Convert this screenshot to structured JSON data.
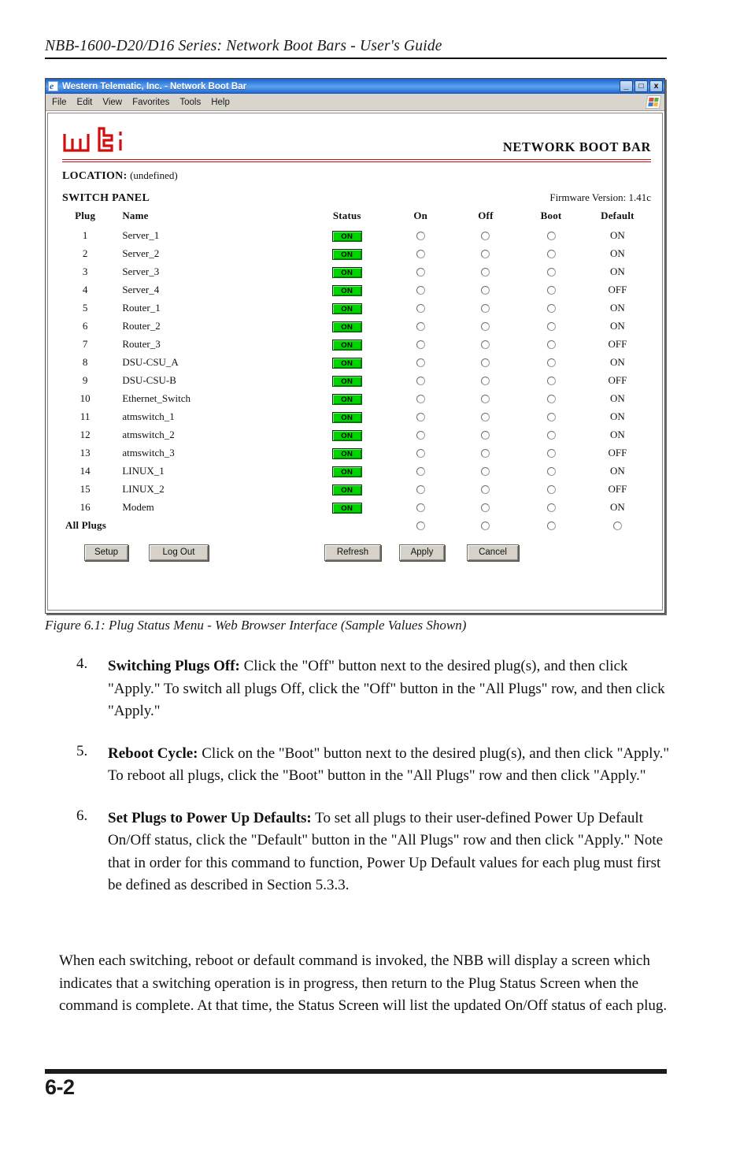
{
  "running_head": "NBB-1600-D20/D16 Series: Network Boot Bars - User's Guide",
  "browser": {
    "title": "Western Telematic, Inc. - Network Boot Bar",
    "title_icon": "internet-explorer-icon",
    "window_buttons": {
      "minimize": "_",
      "maximize": "□",
      "close": "x"
    },
    "menu": [
      "File",
      "Edit",
      "View",
      "Favorites",
      "Tools",
      "Help"
    ],
    "brand_icon": "windows-flag-icon"
  },
  "page": {
    "logo_text": "wti",
    "logo_color": "#d01010",
    "header_title": "NETWORK BOOT BAR",
    "location_label": "LOCATION:",
    "location_value": "(undefined)",
    "panel_title": "SWITCH PANEL",
    "firmware_label": "Firmware Version:",
    "firmware_value": "1.41c",
    "firmware_line": "Firmware Version: 1.41c"
  },
  "table": {
    "headers": [
      "Plug",
      "Name",
      "Status",
      "On",
      "Off",
      "Boot",
      "Default"
    ],
    "status_on_label": "ON",
    "rows": [
      {
        "plug": "1",
        "name": "Server_1",
        "status": "ON",
        "default": "ON"
      },
      {
        "plug": "2",
        "name": "Server_2",
        "status": "ON",
        "default": "ON"
      },
      {
        "plug": "3",
        "name": "Server_3",
        "status": "ON",
        "default": "ON"
      },
      {
        "plug": "4",
        "name": "Server_4",
        "status": "ON",
        "default": "OFF"
      },
      {
        "plug": "5",
        "name": "Router_1",
        "status": "ON",
        "default": "ON"
      },
      {
        "plug": "6",
        "name": "Router_2",
        "status": "ON",
        "default": "ON"
      },
      {
        "plug": "7",
        "name": "Router_3",
        "status": "ON",
        "default": "OFF"
      },
      {
        "plug": "8",
        "name": "DSU-CSU_A",
        "status": "ON",
        "default": "ON"
      },
      {
        "plug": "9",
        "name": "DSU-CSU-B",
        "status": "ON",
        "default": "OFF"
      },
      {
        "plug": "10",
        "name": "Ethernet_Switch",
        "status": "ON",
        "default": "ON"
      },
      {
        "plug": "11",
        "name": "atmswitch_1",
        "status": "ON",
        "default": "ON"
      },
      {
        "plug": "12",
        "name": "atmswitch_2",
        "status": "ON",
        "default": "ON"
      },
      {
        "plug": "13",
        "name": "atmswitch_3",
        "status": "ON",
        "default": "OFF"
      },
      {
        "plug": "14",
        "name": "LINUX_1",
        "status": "ON",
        "default": "ON"
      },
      {
        "plug": "15",
        "name": "LINUX_2",
        "status": "ON",
        "default": "OFF"
      },
      {
        "plug": "16",
        "name": "Modem",
        "status": "ON",
        "default": "ON"
      }
    ],
    "all_plugs_label": "All Plugs"
  },
  "buttons": {
    "setup": "Setup",
    "logout": "Log Out",
    "refresh": "Refresh",
    "apply": "Apply",
    "cancel": "Cancel"
  },
  "figure_caption": "Figure 6.1:  Plug Status Menu - Web Browser Interface (Sample Values Shown)",
  "steps": [
    {
      "number": "4.",
      "title": "Switching Plugs Off:",
      "text": "  Click the \"Off\" button next to the desired plug(s), and then click \"Apply.\"  To switch all plugs Off, click the \"Off\" button in the \"All Plugs\" row, and then click \"Apply.\""
    },
    {
      "number": "5.",
      "title": "Reboot Cycle:",
      "text": "  Click on the \"Boot\" button next to the desired plug(s), and then click \"Apply.\"  To reboot all plugs, click the \"Boot\" button in the \"All Plugs\" row and then click \"Apply.\""
    },
    {
      "number": "6.",
      "title": "Set Plugs to Power Up Defaults:",
      "text": "  To set all plugs to their user-defined Power Up Default On/Off status, click the \"Default\" button in the \"All Plugs\" row and then click \"Apply.\"  Note that in order for this command to function, Power Up Default values for each plug must first be defined as described in Section 5.3.3."
    }
  ],
  "closing_paragraph": "When each switching, reboot or default command is invoked, the NBB will display a screen which indicates that a switching operation is in progress, then return to the Plug Status Screen when the command is complete.  At that time, the Status Screen will list the updated On/Off status of each plug.",
  "folio": "6-2"
}
